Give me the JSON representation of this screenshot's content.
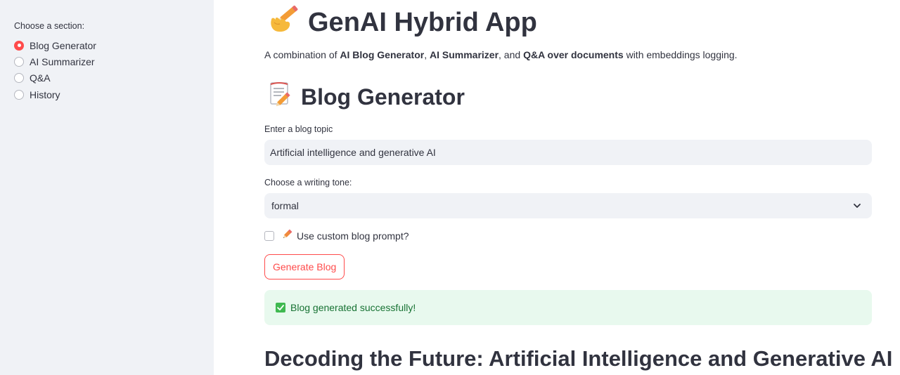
{
  "sidebar": {
    "label": "Choose a section:",
    "items": [
      {
        "label": "Blog Generator",
        "selected": true
      },
      {
        "label": "AI Summarizer",
        "selected": false
      },
      {
        "label": "Q&A",
        "selected": false
      },
      {
        "label": "History",
        "selected": false
      }
    ]
  },
  "header": {
    "title_icon": "writing-hand-emoji",
    "title": "GenAI Hybrid App",
    "description": {
      "prefix": "A combination of ",
      "bold1": "AI Blog Generator",
      "sep1": ", ",
      "bold2": "AI Summarizer",
      "sep2": ", and ",
      "bold3": "Q&A over documents",
      "suffix": " with embeddings logging."
    }
  },
  "section": {
    "icon": "memo-emoji",
    "title": "Blog Generator"
  },
  "topic": {
    "label": "Enter a blog topic",
    "value": "Artificial intelligence and generative AI"
  },
  "tone": {
    "label": "Choose a writing tone:",
    "value": "formal"
  },
  "custom_prompt": {
    "icon": "pencil-icon",
    "label": "Use custom blog prompt?",
    "checked": false
  },
  "generate_button": {
    "label": "Generate Blog"
  },
  "success": {
    "icon": "check-mark-icon",
    "message": "Blog generated successfully!"
  },
  "blog": {
    "title": "Decoding the Future: Artificial Intelligence and Generative AI"
  },
  "colors": {
    "accent": "#ff4b4b",
    "sidebar_bg": "#f0f2f6",
    "success_bg": "#e8f9ee",
    "success_text": "#177233",
    "text": "#31333f"
  }
}
